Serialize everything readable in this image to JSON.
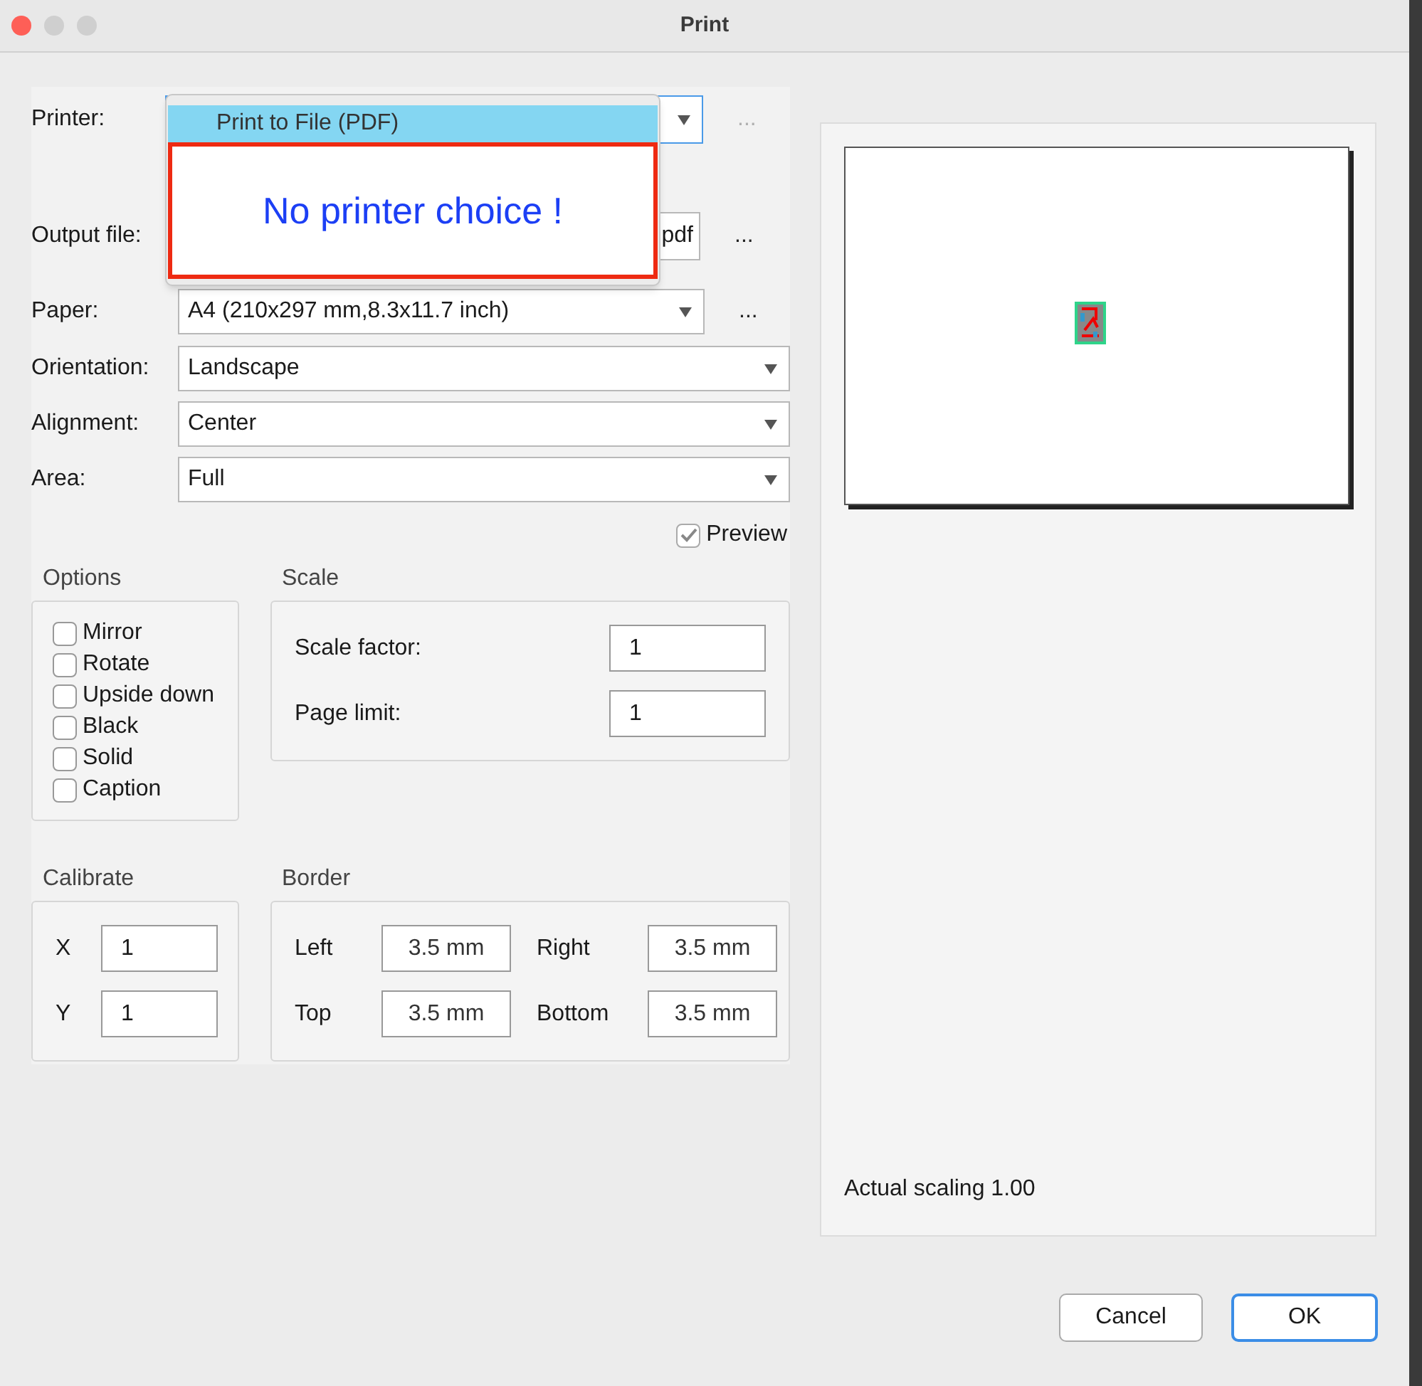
{
  "window": {
    "title": "Print"
  },
  "printer": {
    "label": "Printer:",
    "more": "...",
    "more_disabled": true
  },
  "popup": {
    "items": [
      {
        "label": "Print to File (PDF)",
        "selected": true
      }
    ],
    "message": "No printer choice !"
  },
  "output_file": {
    "label": "Output file:",
    "value": "pdf",
    "more": "...",
    "more_disabled": false
  },
  "paper": {
    "label": "Paper:",
    "value": "A4 (210x297 mm,8.3x11.7 inch)",
    "more": "...",
    "more_disabled": false
  },
  "selects": [
    {
      "label": "Orientation:",
      "value": "Landscape"
    },
    {
      "label": "Alignment:",
      "value": "Center"
    },
    {
      "label": "Area:",
      "value": "Full"
    }
  ],
  "preview": {
    "label": "Preview",
    "checked": true
  },
  "options": {
    "title": "Options",
    "items": [
      {
        "label": "Mirror",
        "checked": false
      },
      {
        "label": "Rotate",
        "checked": false
      },
      {
        "label": "Upside down",
        "checked": false
      },
      {
        "label": "Black",
        "checked": false
      },
      {
        "label": "Solid",
        "checked": false
      },
      {
        "label": "Caption",
        "checked": false
      }
    ]
  },
  "scale": {
    "title": "Scale",
    "fields": [
      {
        "label": "Scale factor:",
        "value": "1"
      },
      {
        "label": "Page limit:",
        "value": "1"
      }
    ]
  },
  "calibrate": {
    "title": "Calibrate",
    "fields": [
      {
        "label": "X",
        "value": "1"
      },
      {
        "label": "Y",
        "value": "1"
      }
    ]
  },
  "border": {
    "title": "Border",
    "fields": [
      {
        "label": "Left",
        "value": "3.5 mm"
      },
      {
        "label": "Right",
        "value": "3.5 mm"
      },
      {
        "label": "Top",
        "value": "3.5 mm"
      },
      {
        "label": "Bottom",
        "value": "3.5 mm"
      }
    ]
  },
  "preview_panel": {
    "caption": "Actual scaling 1.00"
  },
  "buttons": [
    {
      "label": "Cancel",
      "default": false
    },
    {
      "label": "OK",
      "default": true
    }
  ]
}
